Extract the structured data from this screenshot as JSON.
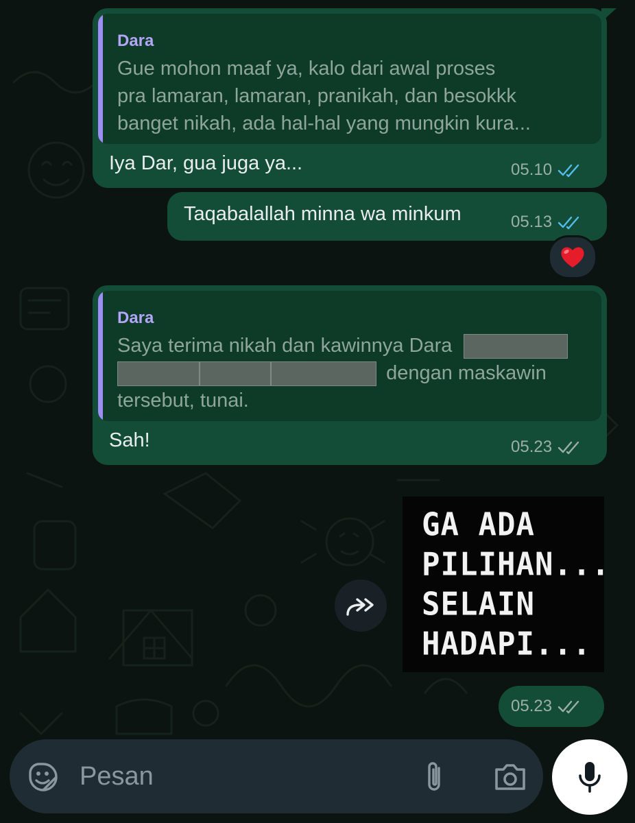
{
  "colors": {
    "outgoing_bubble": "#144d37",
    "quote_bar": "#9c8ef2",
    "read_ticks": "#53bdeb",
    "delivered_ticks": "#9bb0a6"
  },
  "messages": [
    {
      "quote": {
        "name": "Dara",
        "lines": [
          "Gue mohon maaf ya, kalo dari awal proses",
          "pra lamaran, lamaran, pranikah, dan besokkk",
          "banget nikah, ada hal-hal yang mungkin kura..."
        ]
      },
      "text": "Iya Dar, gua juga ya...",
      "time": "05.10",
      "status": "read"
    },
    {
      "text": "Taqabalallah minna wa minkum",
      "time": "05.13",
      "status": "read",
      "reaction": "❤️"
    },
    {
      "quote": {
        "name": "Dara",
        "line1": "Saya terima nikah dan kawinnya Dara",
        "line2": "dengan maskawin",
        "line3": "tersebut, tunai."
      },
      "text": "Sah!",
      "time": "05.23",
      "status": "delivered"
    },
    {
      "sticker_lines": [
        "GA ADA",
        "PILIHAN...",
        "SELAIN",
        "HADAPI..."
      ],
      "time": "05.23",
      "status": "delivered",
      "forward_icon": "forward-icon"
    }
  ],
  "composer": {
    "placeholder": "Pesan",
    "emoji_icon": "sticker-icon",
    "attach_icon": "paperclip-icon",
    "camera_icon": "camera-icon",
    "mic_icon": "microphone-icon"
  }
}
